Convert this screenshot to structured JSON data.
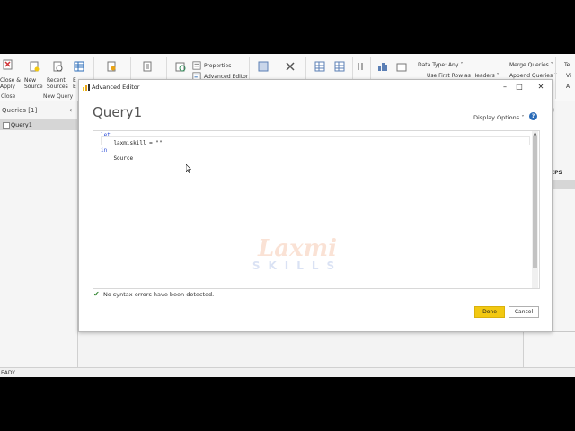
{
  "ribbon": {
    "close_apply": "Close &",
    "close_apply2": "Apply",
    "close_group": "Close",
    "new_source": "New",
    "new_source2": "Source",
    "recent_sources": "Recent",
    "recent_sources2": "Sources",
    "enter_data": "E",
    "enter_data2": "E",
    "new_query_group": "New Query",
    "properties": "Properties",
    "advanced_editor": "Advanced Editor",
    "data_type": "Data Type: Any",
    "first_row": "Use First Row as Headers",
    "merge_queries": "Merge Queries",
    "append_queries": "Append Queries",
    "right_te": "Te",
    "right_vi": "Vi",
    "right_a": "A"
  },
  "left_pane": {
    "header": "Queries [1]",
    "items": [
      {
        "label": "Query1"
      }
    ]
  },
  "right_pane": {
    "steps_label": "EPS",
    "g_label": "g"
  },
  "status_bar": {
    "text": "EADY"
  },
  "dialog": {
    "title": "Advanced Editor",
    "query_name": "Query1",
    "display_options": "Display Options",
    "help": "?",
    "code_lines": {
      "line1": "let",
      "line2": "    laxmiskill = \"\"",
      "line3": "in",
      "line4": "    Source"
    },
    "syntax_status": "No syntax errors have been detected.",
    "done_label": "Done",
    "cancel_label": "Cancel"
  },
  "watermark": {
    "line1": "Laxmi",
    "line2": "SKILLS"
  },
  "colors": {
    "accent_yellow": "#f2c811",
    "keyword_blue": "#2a4bd7",
    "check_green": "#3a8a3a"
  }
}
